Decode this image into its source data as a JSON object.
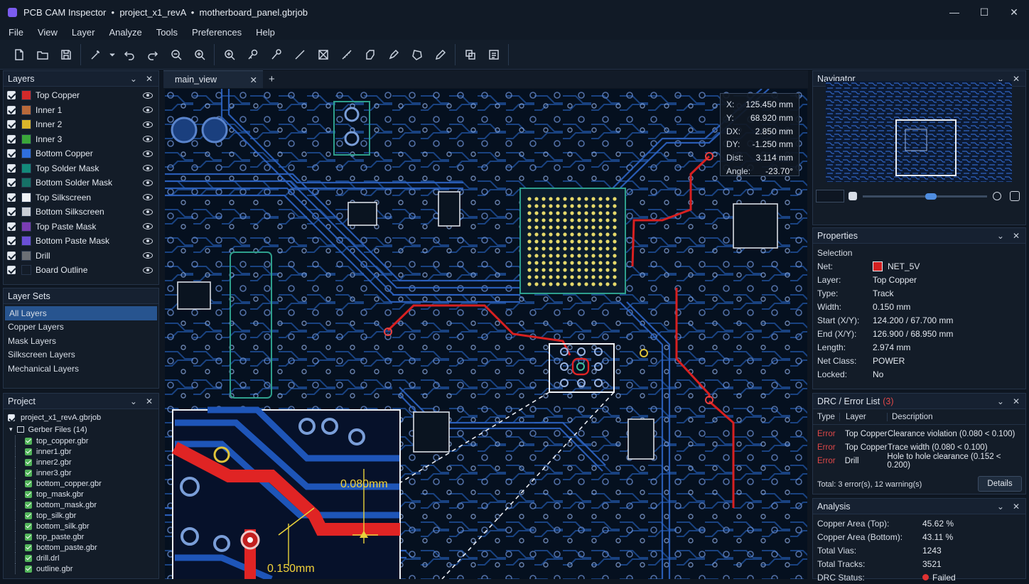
{
  "window": {
    "app_name": "PCB CAM Inspector",
    "title": "PCB CAM Inspector  •  project_x1_revA  •  motherboard_panel.gbrjob",
    "controls": [
      "—",
      "☐",
      "✕"
    ]
  },
  "menu": [
    "File",
    "View",
    "Layer",
    "Analyze",
    "Tools",
    "Preferences",
    "Help"
  ],
  "toolbar": {
    "icons": [
      "new-file-icon",
      "open-folder-icon",
      "save-icon",
      "magic-select-icon",
      "dropdown-arrow-icon",
      "undo-icon",
      "redo-icon",
      "zoom-out-icon",
      "zoom-in-icon",
      "zoom-area-icon",
      "probe-icon",
      "measure-icon",
      "line-icon",
      "fit-icon",
      "ruler-icon",
      "shape-icon",
      "pen-icon",
      "polygon-icon",
      "pencil-icon",
      "compare-icon",
      "report-icon"
    ]
  },
  "layers_panel": {
    "title": "Layers",
    "layers": [
      {
        "name": "Top Copper",
        "color": "#d32a2a"
      },
      {
        "name": "Inner 1",
        "color": "#b8693a"
      },
      {
        "name": "Inner 2",
        "color": "#d9b52a"
      },
      {
        "name": "Inner 3",
        "color": "#3aa63a"
      },
      {
        "name": "Bottom Copper",
        "color": "#2f6fdd"
      },
      {
        "name": "Top Solder Mask",
        "color": "#138a7a"
      },
      {
        "name": "Bottom Solder Mask",
        "color": "#167066"
      },
      {
        "name": "Top Silkscreen",
        "color": "#eef1f5"
      },
      {
        "name": "Bottom Silkscreen",
        "color": "#c9ced6"
      },
      {
        "name": "Top Paste Mask",
        "color": "#7a3db3"
      },
      {
        "name": "Bottom Paste Mask",
        "color": "#6a4fd6"
      },
      {
        "name": "Drill",
        "color": "#6b6f75"
      },
      {
        "name": "Board Outline",
        "color": "#131c28"
      }
    ]
  },
  "layer_sets": {
    "title": "Layer Sets",
    "items": [
      "All Layers",
      "Copper Layers",
      "Mask Layers",
      "Silkscreen Layers",
      "Mechanical Layers"
    ],
    "selected": 0
  },
  "project": {
    "title": "Project",
    "root": "project_x1_revA.gbrjob",
    "folder": "Gerber Files (14)",
    "files": [
      "top_copper.gbr",
      "inner1.gbr",
      "inner2.gbr",
      "inner3.gbr",
      "bottom_copper.gbr",
      "top_mask.gbr",
      "bottom_mask.gbr",
      "top_silk.gbr",
      "bottom_silk.gbr",
      "top_paste.gbr",
      "bottom_paste.gbr",
      "drill.drl",
      "outline.gbr"
    ]
  },
  "tabs": {
    "active": "main_view",
    "plus": "+",
    "close": "✕"
  },
  "coords": [
    {
      "k": "X:",
      "v": "125.450 mm"
    },
    {
      "k": "Y:",
      "v": "68.920 mm"
    },
    {
      "k": "DX:",
      "v": "2.850 mm"
    },
    {
      "k": "DY:",
      "v": "-1.250 mm"
    },
    {
      "k": "Dist:",
      "v": "3.114 mm"
    },
    {
      "k": "Angle:",
      "v": "-23.70°"
    }
  ],
  "inset": {
    "dim1": "0.080mm",
    "dim2": "0.150mm"
  },
  "navigator": {
    "title": "Navigator"
  },
  "properties": {
    "title": "Properties",
    "section": "Selection",
    "rows": [
      {
        "k": "Net:",
        "v": "NET_5V",
        "swatch": "#d42121"
      },
      {
        "k": "Layer:",
        "v": "Top Copper"
      },
      {
        "k": "Type:",
        "v": "Track"
      },
      {
        "k": "Width:",
        "v": "0.150 mm"
      },
      {
        "k": "Start (X/Y):",
        "v": "124.200 / 67.700 mm"
      },
      {
        "k": "End (X/Y):",
        "v": "126.900 / 68.950 mm"
      },
      {
        "k": "Length:",
        "v": "2.974 mm"
      },
      {
        "k": "Net Class:",
        "v": "POWER"
      },
      {
        "k": "Locked:",
        "v": "No"
      }
    ]
  },
  "drc": {
    "title": "DRC / Error List",
    "count": "(3)",
    "headers": [
      "Type",
      "Layer",
      "Description"
    ],
    "rows": [
      {
        "t": "Error",
        "l": "Top Copper",
        "d": "Clearance violation (0.080 < 0.100)"
      },
      {
        "t": "Error",
        "l": "Top Copper",
        "d": "Trace width (0.080 < 0.100)"
      },
      {
        "t": "Error",
        "l": "Drill",
        "d": "Hole to hole clearance (0.152 < 0.200)"
      }
    ],
    "total": "Total: 3 error(s), 12 warning(s)",
    "details_button": "Details"
  },
  "analysis": {
    "title": "Analysis",
    "rows": [
      {
        "k": "Copper Area (Top):",
        "v": "45.62 %"
      },
      {
        "k": "Copper Area (Bottom):",
        "v": "43.11 %"
      },
      {
        "k": "Total Vias:",
        "v": "1243"
      },
      {
        "k": "Total Tracks:",
        "v": "3521"
      },
      {
        "k": "DRC Status:",
        "v": "Failed",
        "status_color": "#e03232"
      }
    ]
  }
}
